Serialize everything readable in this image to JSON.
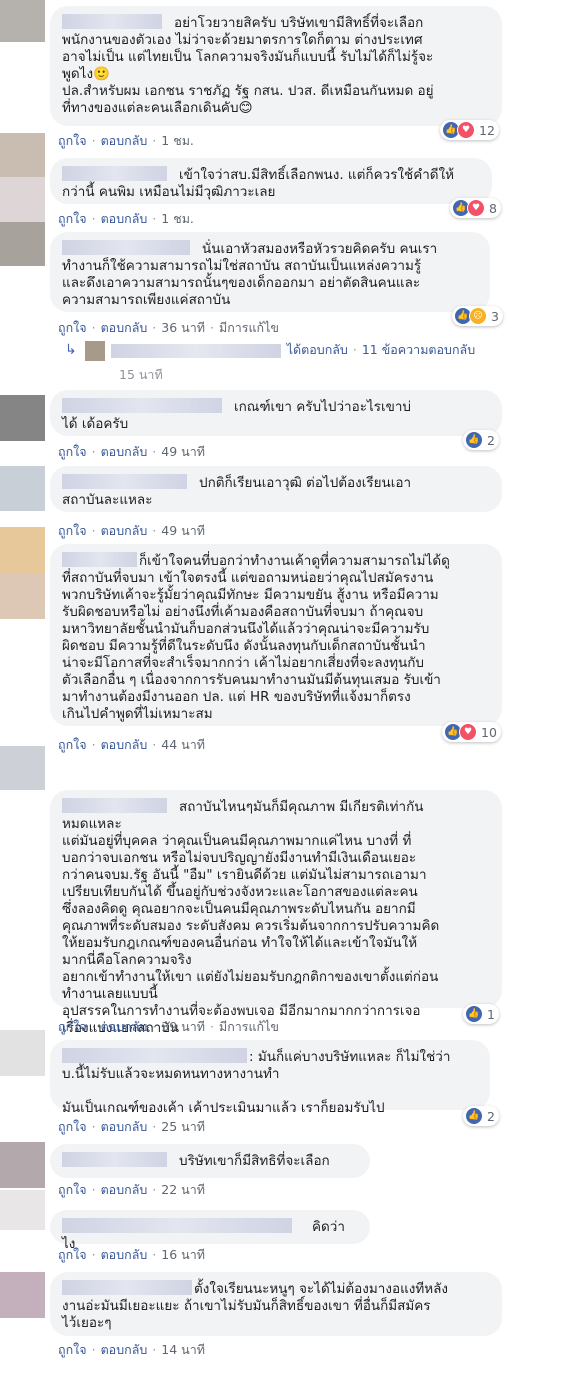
{
  "common": {
    "like": "ถูกใจ",
    "reply": "ตอบกลับ",
    "edited": "มีการแก้ไข"
  },
  "comments": [
    {
      "text": "อย่าโวยวายสิครับ บริษัทเขามีสิทธิ์ที่จะเลือก\nพนักงานของตัวเอง ไม่ว่าจะด้วยมาตรการใดก็ตาม ต่างประเทศ\nอาจไม่เป็น แต่ไทยเป็น โลกความจริงมันก็แบบนี้ รับไม่ได้ก็ไม่รู้จะ\nพูดไง🙂\nปล.สำหรับผม เอกชน ราชภัฏ รัฐ กสน. ปวส. ดีเหมือนกันหมด อยู่\nที่ทางของแต่ละคนเลือกเดินคับ😊",
      "time": "1 ชม.",
      "count": "12"
    },
    {
      "text": "เข้าใจว่าสบ.มีสิทธิ์เลือกพนง. แต่ก็ควรใช้คำดีให้\nกว่านี้ คนพิม เหมือนไม่มีวุฒิภาวะเลย",
      "time": "1 ชม.",
      "count": "8"
    },
    {
      "text": "นั่นเอาหัวสมองหรือหัวรวยคิดครับ คนเรา\nทำงานก็ใช้ความสามารถไม่ใช่สถาบัน สถาบันเป็นแหล่งความรู้\nและดึงเอาความสามารถนั้นๆของเด็กออกมา อย่าตัดสินคนและ\nความสามารถเพียงแค่สถาบัน",
      "time": "36 นาที",
      "count": "3",
      "replies": {
        "label": "ได้ตอบกลับ",
        "count": "11 ข้อความตอบกลับ",
        "time": "15 นาที"
      }
    },
    {
      "text": "เกณฑ์เขา ครับไปว่าอะไรเขาบ่\nได้ เด้อครับ",
      "time": "49 นาที",
      "count": "2"
    },
    {
      "text": "ปกติก็เรียนเอาวุฒิ ต่อไปต้องเรียนเอา\nสถาบันละแหละ",
      "time": "49 นาที"
    },
    {
      "text": "ก็เข้าใจคนที่บอกว่าทำงานเค้าดูที่ความสามารถไม่ได้ดู\nที่สถาบันที่จบมา เข้าใจตรงนี้ แต่ขอถามหน่อยว่าคุณไปสมัครงาน\nพวกบริษัทเค้าจะรู้มั้ยว่าคุณมีทักษะ มีความขยัน สู้งาน หรือมีความ\nรับผิดชอบหรือไม่ อย่างนึงที่เค้ามองคือสถาบันที่จบมา ถ้าคุณจบ\nมหาวิทยาลัยชั้นนำมันก็บอกส่วนนึงได้แล้วว่าคุณน่าจะมีความรับ\nผิดชอบ มีความรู้ที่ดีในระดับนึง ดังนั้นลงทุนกับเด็กสถาบันชั้นนำ\nน่าจะมีโอกาสที่จะสำเร็จมากกว่า เค้าไม่อยากเสี่ยงที่จะลงทุนกับ\nตัวเลือกอื่น ๆ เนื่องจากการรับคนมาทำงานมันมีต้นทุนเสมอ รับเข้า\nมาทำงานต้องมีงานออก ปล. แต่ HR ของบริษัทที่แจ้งมาก็ตรง\nเกินไปคำพูดที่ไม่เหมาะสม",
      "time": "44 นาที",
      "count": "10"
    },
    {
      "text": "สถาบันไหนๆมันก็มีคุณภาพ มีเกียรติเท่ากัน\nหมดแหละ\nแต่มันอยู่ที่บุคคล ว่าคุณเป็นคนมีคุณภาพมากแค่ไหน บางที่ ที่\nบอกว่าจบเอกชน หรือไม่จบปริญญายังมีงานทำมีเงินเดือนเยอะ\nกว่าคนจบม.รัฐ อันนี้ \"อืม\" เรายินดีด้วย แต่มันไม่สามารถเอามา\nเปรียบเทียบกันได้ ขึ้นอยู่กับช่วงจังหวะและโอกาสของแต่ละคน\nซึ่งลองคิดดู คุณอยากจะเป็นคนมีคุณภาพระดับไหนกัน อยากมี\nคุณภาพที่ระดับสมอง ระดับสังคม ควรเริ่มต้นจากการปรับความคิด\nให้ยอมรับกฎเกณฑ์ของคนอื่นก่อน ทำใจให้ได้และเข้าใจมันให้\nมากนี่คือโลกความจริง\nอยากเข้าทำงานให้เขา แต่ยังไม่ยอมรับกฎกติกาของเขาตั้งแต่ก่อน\nทำงานเลยแบบนี้\nอุปสรรคในการทำงานที่จะต้องพบเจอ มีอีกมากมากกว่าการเจอ\nเรื่องแบ่งแยกสถาบัน",
      "time": "39 นาที",
      "count": "1"
    },
    {
      "text": ": มันก็แค่บางบริษัทแหละ ก็ไม่ใช่ว่า\nบ.นี้ไม่รับแล้วจะหมดหนทางหางานทำ\n\nมันเป็นเกณฑ์ของเค้า เค้าประเมินมาแล้ว เราก็ยอมรับไป",
      "time": "25 นาที",
      "count": "2"
    },
    {
      "text": "บริษัทเขาก็มีสิทธิที่จะเลือก",
      "time": "22 นาที"
    },
    {
      "text": "คิดว่าไง",
      "time": "16 นาที"
    },
    {
      "text": "ตั้งใจเรียนนะหนูๆ จะได้ไม่ต้องมางอแงทีหลัง\nงานอ่ะมันมีเยอะแยะ ถ้าเขาไม่รับมันก็สิทธิ์ของเขา ที่อื่นก็มีสมัคร\nไว้เยอะๆ",
      "time": "14 นาที"
    }
  ]
}
